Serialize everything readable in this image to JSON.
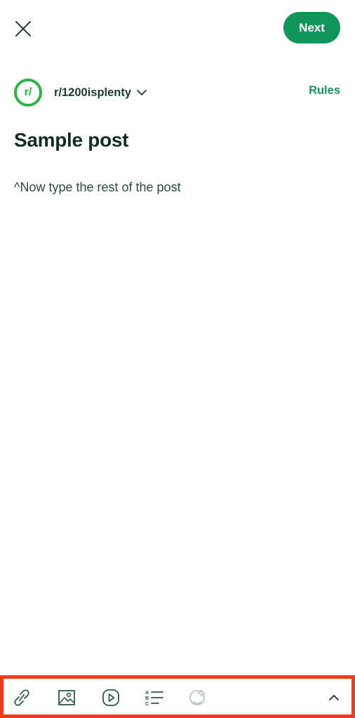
{
  "header": {
    "close_icon": "close-icon",
    "next_label": "Next"
  },
  "community": {
    "avatar_text": "r/",
    "name": "r/1200isplenty",
    "dropdown_icon": "chevron-down-icon",
    "rules_label": "Rules"
  },
  "post": {
    "title": "Sample post",
    "body": "^Now type the rest of the post"
  },
  "toolbar": {
    "tools": [
      "link-icon",
      "image-icon",
      "video-icon",
      "list-icon",
      "ai-assist-icon",
      "chevron-up-icon"
    ]
  },
  "colors": {
    "accent": "#12955a",
    "avatar_ring": "#2bb34a",
    "highlight_border": "#f2391c",
    "title_text": "#112e1f"
  }
}
